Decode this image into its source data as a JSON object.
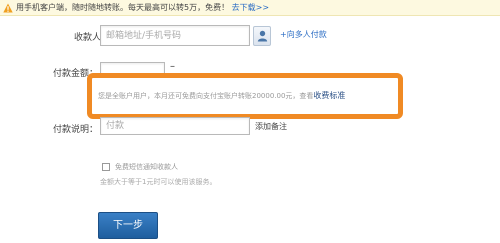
{
  "notice": {
    "text": "用手机客户端，随时随地转账。每天最高可以转5万，免费！",
    "link": "去下载>>"
  },
  "form": {
    "payee": {
      "label": "收款人：",
      "placeholder": "邮箱地址/手机号码",
      "add_multi_link": "+向多人付款"
    },
    "amount": {
      "label": "付款金额：",
      "value": "",
      "dash": "–"
    },
    "fee_info": {
      "text": "您是全账户用户，本月还可免费向支付宝账户转账20000.00元，查看",
      "link": "收费标准"
    },
    "note": {
      "label": "付款说明：",
      "placeholder": "付款",
      "add_note_link": "添加备注"
    },
    "sms_notify": {
      "checked": false,
      "label": "免费短信通知收款人",
      "hint": "金额大于等于1元时可以使用该服务。"
    },
    "next_button": "下一步"
  },
  "colors": {
    "highlight_border": "#f08a24",
    "link": "#2a6cc4",
    "button": "#2a6fb2"
  },
  "icons": [
    "warning-icon",
    "contact-icon"
  ]
}
